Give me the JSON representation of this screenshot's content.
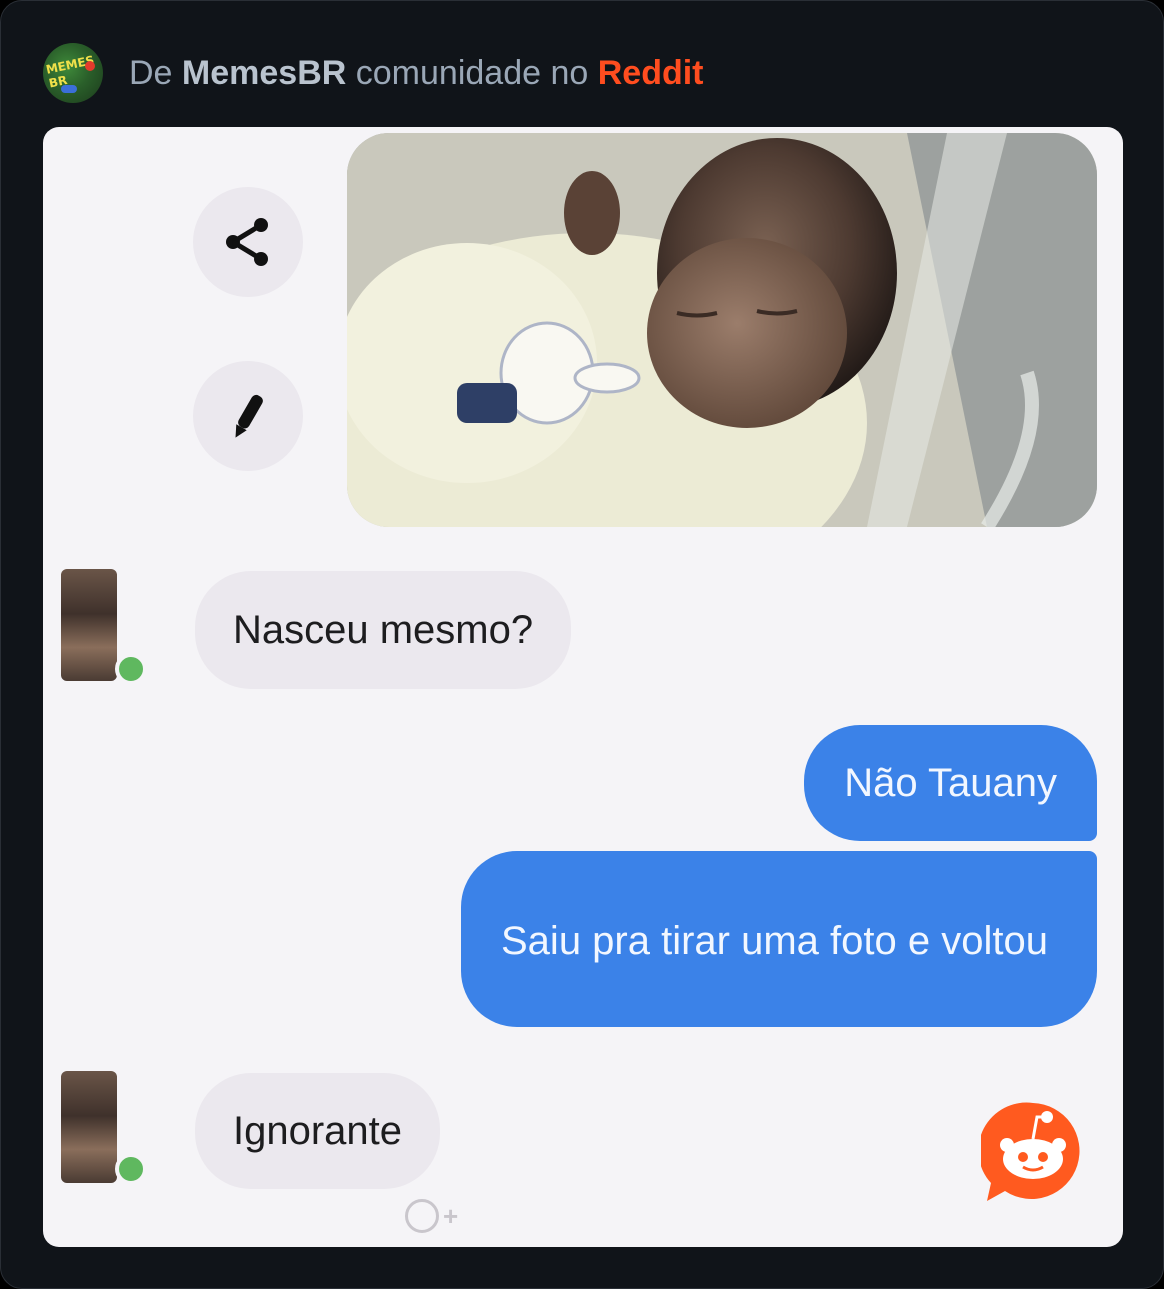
{
  "header": {
    "community_avatar_text": "MEMES BR",
    "prefix": "De",
    "community": "MemesBR",
    "middle": "comunidade no",
    "platform": "Reddit",
    "colors": {
      "platform": "#ff4d1f",
      "community": "#b9c3ce",
      "text": "#9aa7b6"
    }
  },
  "chat": {
    "actions": [
      {
        "icon": "share-icon"
      },
      {
        "icon": "pencil-icon"
      }
    ],
    "photo": {
      "subject": "sleeping-newborn-photo"
    },
    "messages": [
      {
        "side": "in",
        "text": "Nasceu mesmo?"
      },
      {
        "side": "out",
        "text": "Não Tauany"
      },
      {
        "side": "out",
        "text": "Saiu pra tirar uma foto e voltou"
      },
      {
        "side": "in",
        "text": "Ignorante"
      }
    ],
    "reaction_icon": "add-reaction-icon",
    "colors": {
      "incoming_bubble": "#ebe8ee",
      "outgoing_bubble": "#3b82e8",
      "online": "#5fb85f"
    }
  },
  "watermark": {
    "icon": "reddit-snoo-icon",
    "color": "#ff5a1f"
  }
}
